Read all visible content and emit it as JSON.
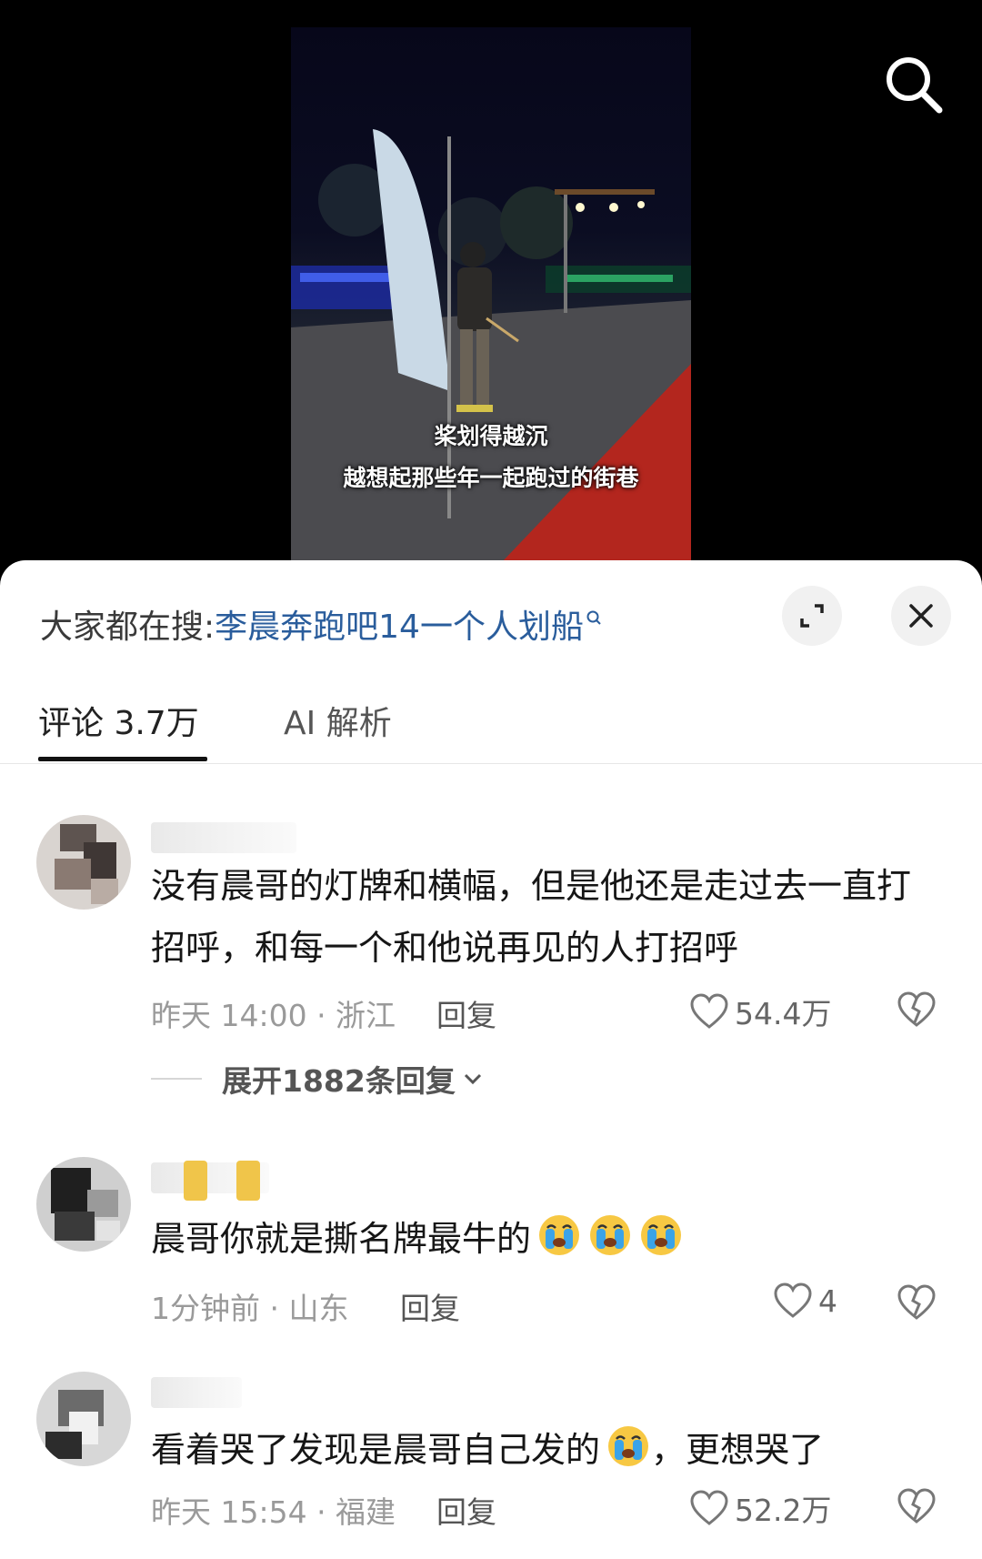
{
  "video": {
    "caption_line1": "桨划得越沉",
    "caption_line2": "越想起那些年一起跑过的街巷"
  },
  "search": {
    "icon": "search-icon"
  },
  "trending": {
    "prefix": "大家都在搜:",
    "keyword": "李晨奔跑吧14一个人划船"
  },
  "header_buttons": {
    "expand_icon": "expand-icon",
    "close_icon": "close-icon"
  },
  "tabs": [
    {
      "label": "评论 3.7万",
      "active": true
    },
    {
      "label": "AI 解析",
      "active": false
    }
  ],
  "comments": [
    {
      "text": "没有晨哥的灯牌和横幅，但是他还是走过去一直打招呼，和每一个和他说再见的人打招呼",
      "time": "昨天 14:00",
      "location": "浙江",
      "meta": "昨天 14:00 · 浙江",
      "reply_label": "回复",
      "likes": "54.4万",
      "expand_label": "展开1882条回复"
    },
    {
      "text": "晨哥你就是撕名牌最牛的",
      "emoji_count": 3,
      "time": "1分钟前",
      "location": "山东",
      "meta": "1分钟前 · 山东",
      "reply_label": "回复",
      "likes": "4"
    },
    {
      "text_before_emoji": "看着哭了发现是晨哥自己发的",
      "text_after_emoji": "，更想哭了",
      "time": "昨天 15:54",
      "location": "福建",
      "meta": "昨天 15:54 · 福建",
      "reply_label": "回复",
      "likes": "52.2万"
    }
  ],
  "colors": {
    "keyword": "#2a5d9c",
    "meta_gray": "#9a9a9a",
    "sheet_bg": "#ffffff",
    "video_bg": "#000000",
    "carpet_red": "#b3261e"
  }
}
